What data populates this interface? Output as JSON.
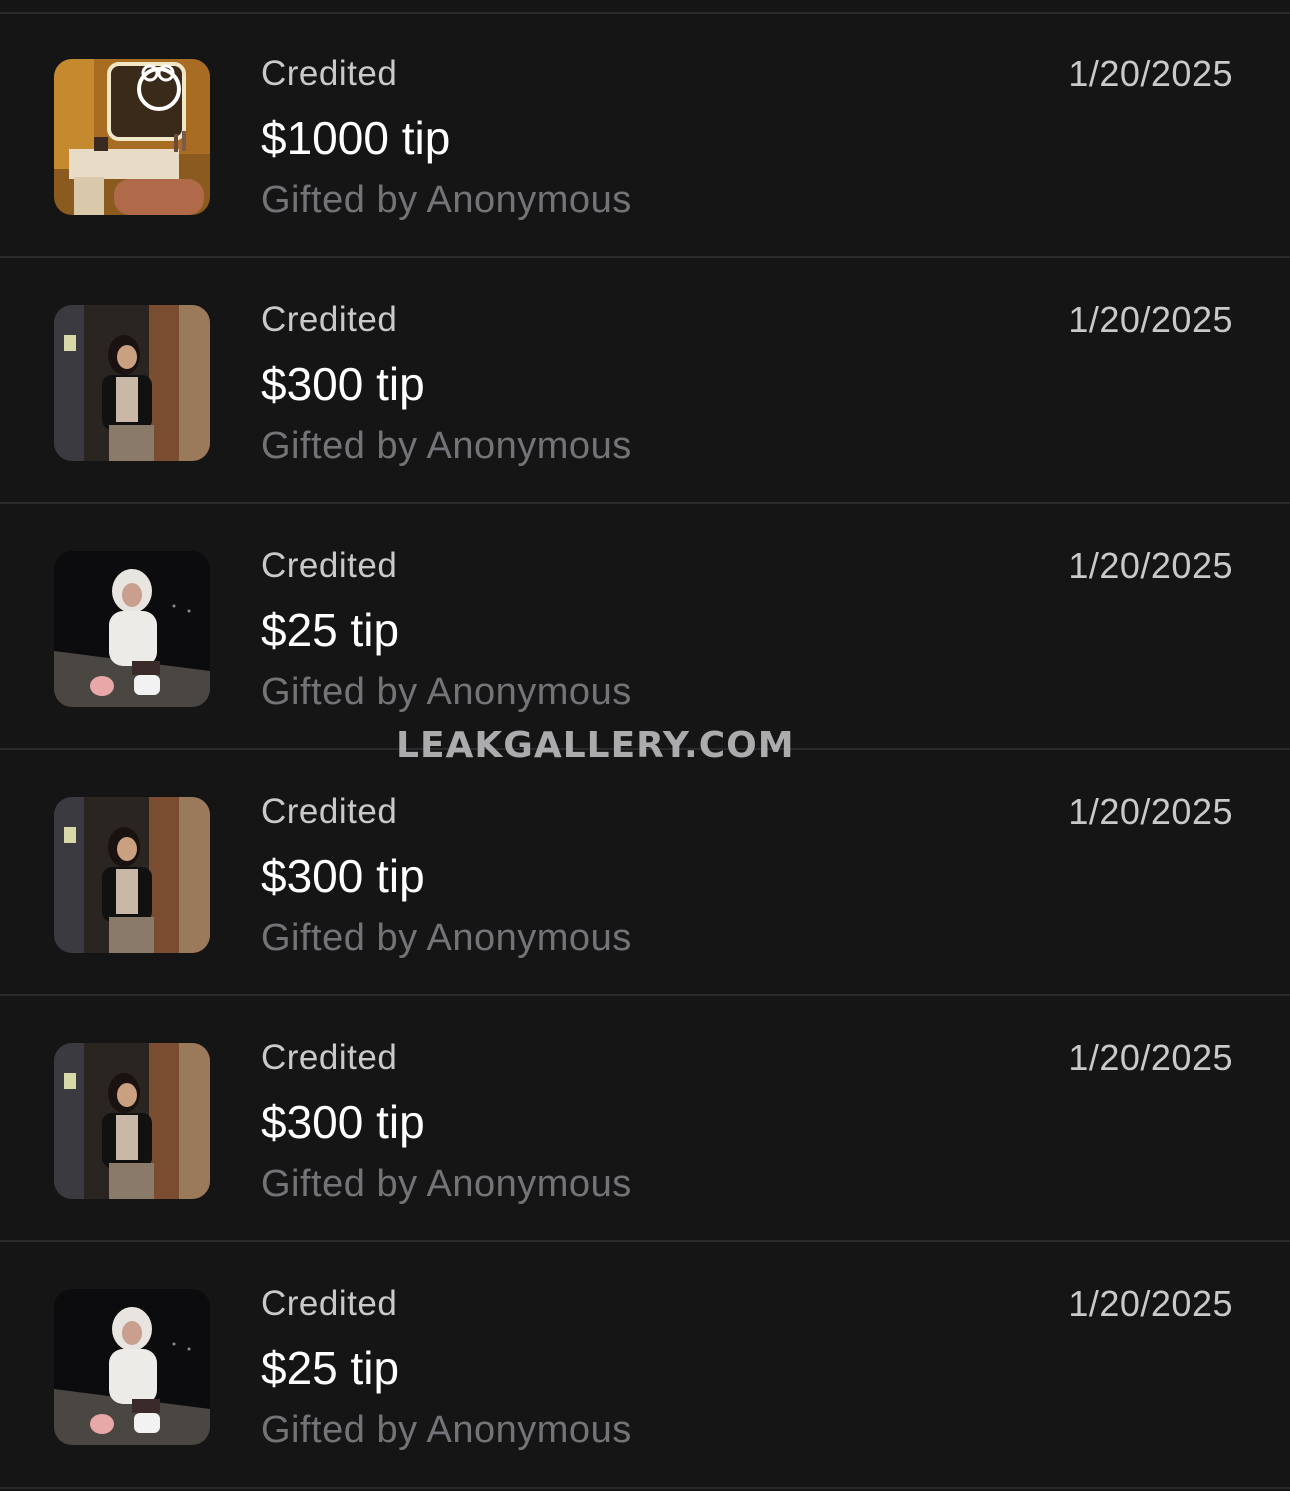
{
  "transactions": [
    {
      "status": "Credited",
      "amount": "$1000 tip",
      "gifted": "Gifted by Anonymous",
      "date": "1/20/2025",
      "thumbnail": "vanity-room-photo"
    },
    {
      "status": "Credited",
      "amount": "$300 tip",
      "gifted": "Gifted by Anonymous",
      "date": "1/20/2025",
      "thumbnail": "person-indoor-photo"
    },
    {
      "status": "Credited",
      "amount": "$25 tip",
      "gifted": "Gifted by Anonymous",
      "date": "1/20/2025",
      "thumbnail": "person-night-photo"
    },
    {
      "status": "Credited",
      "amount": "$300 tip",
      "gifted": "Gifted by Anonymous",
      "date": "1/20/2025",
      "thumbnail": "person-indoor-photo"
    },
    {
      "status": "Credited",
      "amount": "$300 tip",
      "gifted": "Gifted by Anonymous",
      "date": "1/20/2025",
      "thumbnail": "person-indoor-photo"
    },
    {
      "status": "Credited",
      "amount": "$25 tip",
      "gifted": "Gifted by Anonymous",
      "date": "1/20/2025",
      "thumbnail": "person-night-photo"
    }
  ],
  "watermark": "LEAKGALLERY.COM",
  "colors": {
    "background": "#151516",
    "divider": "#2a2a2c",
    "primary_text": "#ffffff",
    "secondary_text": "#c9c9cc",
    "muted_text": "#747478"
  }
}
